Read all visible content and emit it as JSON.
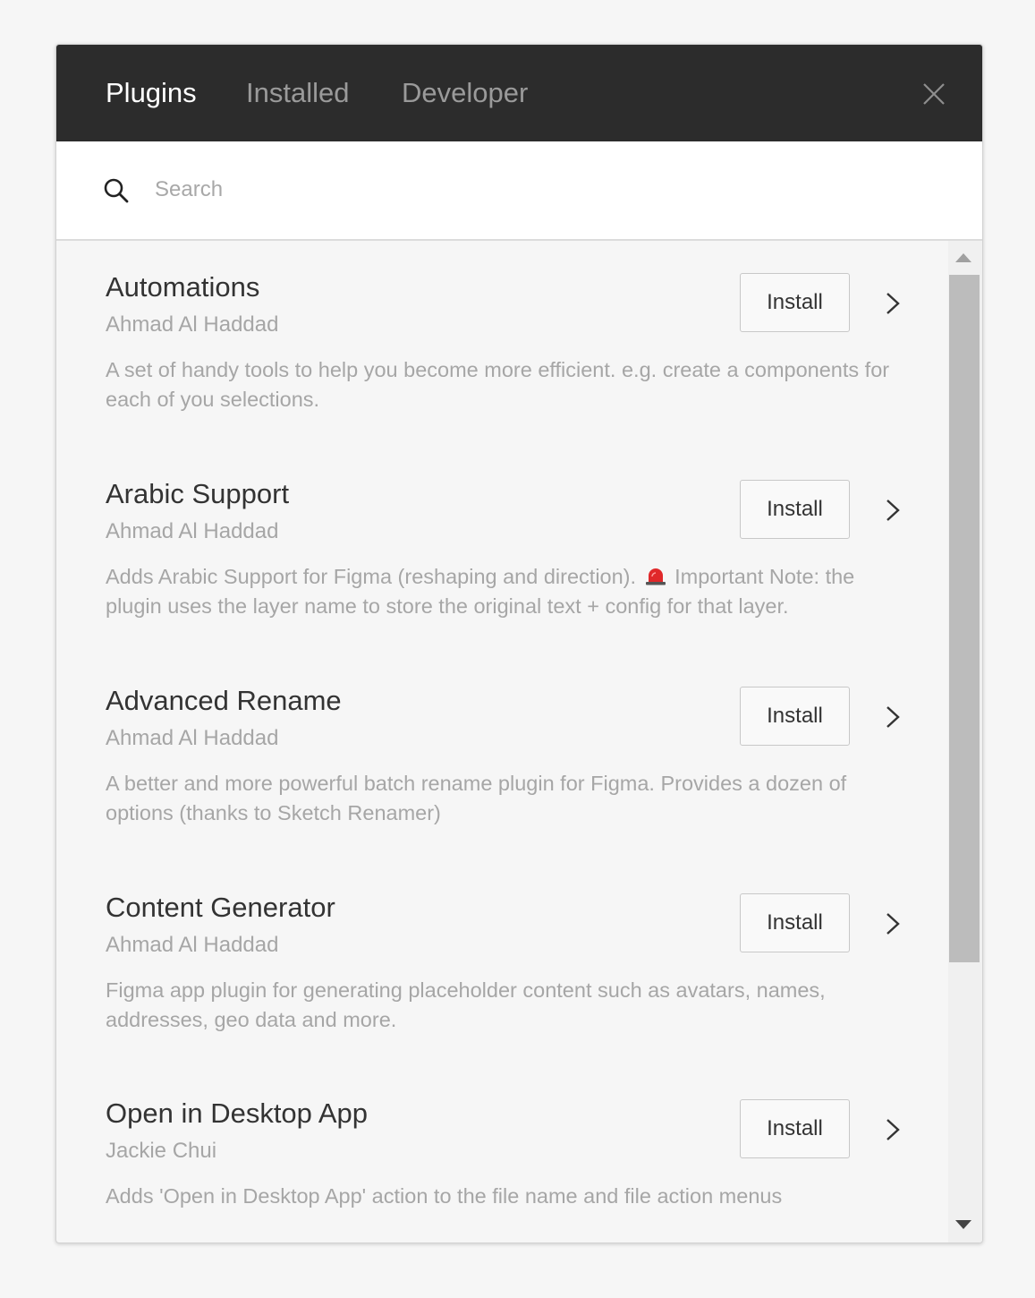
{
  "tabs": {
    "plugins": "Plugins",
    "installed": "Installed",
    "developer": "Developer"
  },
  "search": {
    "placeholder": "Search",
    "value": ""
  },
  "plugins": [
    {
      "name": "Automations",
      "author": "Ahmad Al Haddad",
      "description": "A set of handy tools to help you become more efficient. e.g. create a components for each of you selections.",
      "button": "Install"
    },
    {
      "name": "Arabic Support",
      "author": "Ahmad Al Haddad",
      "description_before": "Adds Arabic Support for Figma (reshaping and direction).",
      "description_after": "Important Note: the plugin uses the layer name to store the original text + config for that layer.",
      "button": "Install"
    },
    {
      "name": "Advanced Rename",
      "author": "Ahmad Al Haddad",
      "description": "A better and more powerful batch rename plugin for Figma. Provides a dozen of options (thanks to Sketch Renamer)",
      "button": "Install"
    },
    {
      "name": "Content Generator",
      "author": "Ahmad Al Haddad",
      "description": "Figma app plugin for generating placeholder content such as avatars, names, addresses, geo data and more.",
      "button": "Install"
    },
    {
      "name": "Open in Desktop App",
      "author": "Jackie Chui",
      "description": "Adds 'Open in Desktop App' action to the file name and file action menus",
      "button": "Install"
    }
  ],
  "icons": {
    "close": "close-icon",
    "search": "search-icon",
    "chevron": "chevron-right-icon",
    "alert": "rotating-light-icon"
  },
  "colors": {
    "header_bg": "#2c2c2c",
    "active_tab": "#ffffff",
    "inactive_tab": "#9a9a9a",
    "muted_text": "#a6a6a6",
    "scroll_thumb": "#bcbcbc"
  }
}
